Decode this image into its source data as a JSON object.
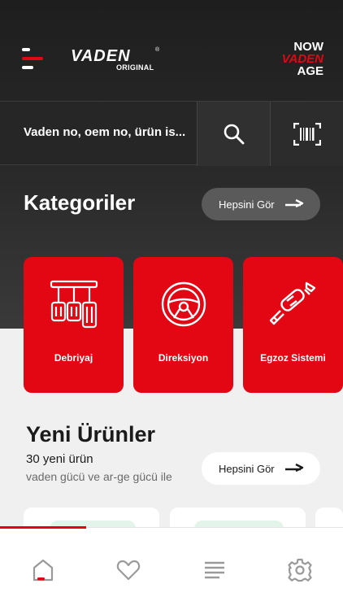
{
  "header": {
    "logo": {
      "brand": "VADEN",
      "sub": "ORIGINAL",
      "mark": "®"
    },
    "tagline": {
      "line1": "NOW",
      "line2": "VADEN",
      "line3": "AGE"
    }
  },
  "search": {
    "placeholder": "Vaden no, oem no, ürün is..."
  },
  "categories": {
    "title": "Kategoriler",
    "see_all": "Hepsini Gör",
    "items": [
      {
        "label": "Debriyaj",
        "icon": "pedals-icon"
      },
      {
        "label": "Direksiyon",
        "icon": "steering-wheel-icon"
      },
      {
        "label": "Egzoz Sistemi",
        "icon": "exhaust-icon"
      }
    ]
  },
  "new_products": {
    "title": "Yeni Ürünler",
    "count": "30 yeni ürün",
    "subtitle": "vaden gücü ve ar-ge gücü ile",
    "see_all": "Hepsini Gör"
  },
  "tabbar": {
    "items": [
      "home-icon",
      "heart-icon",
      "list-icon",
      "settings-icon"
    ],
    "active_index": 0
  },
  "colors": {
    "accent": "#e30613",
    "dark_bg": "#242424",
    "light_bg": "#f0f0f0"
  }
}
